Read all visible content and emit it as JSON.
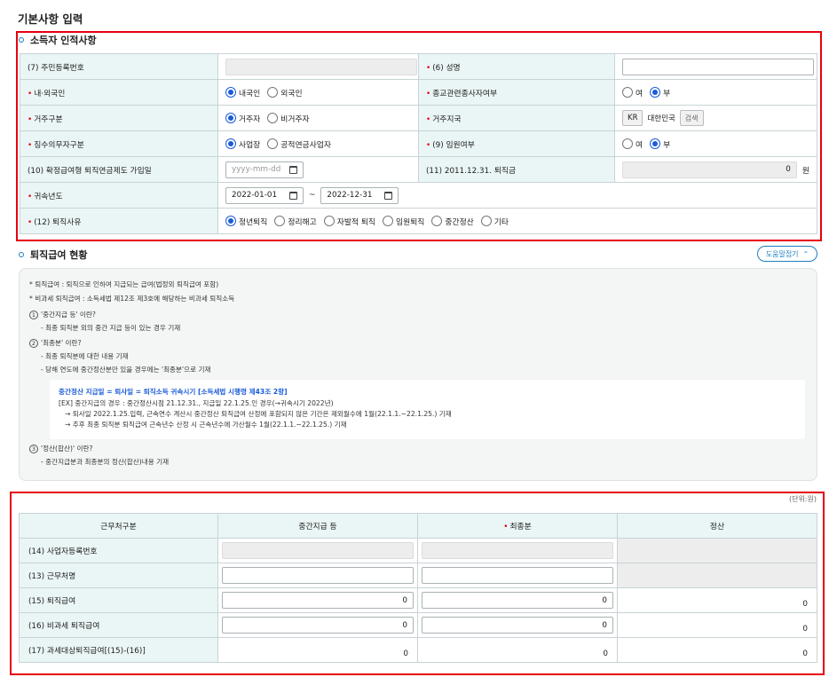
{
  "page_title": "기본사항 입력",
  "section1": {
    "title": "소득자 인적사항",
    "rows": {
      "resident_id_label": "(7) 주민등록번호",
      "name_label": "(6) 성명",
      "nationality_label": "내·외국인",
      "nationality_options": [
        "내국인",
        "외국인"
      ],
      "religion_label": "종교관련종사자여부",
      "religion_options": [
        "여",
        "부"
      ],
      "residence_label": "거주구분",
      "residence_options": [
        "거주자",
        "비거주자"
      ],
      "country_label": "거주지국",
      "country_code": "KR",
      "country_name": "대한민국",
      "country_search": "검색",
      "withholding_label": "징수의무자구분",
      "withholding_options": [
        "사업장",
        "공적연금사업자"
      ],
      "executive_label": "(9) 임원여부",
      "executive_options": [
        "여",
        "부"
      ],
      "pension_label": "(10) 확정급여형 퇴직연금제도 가입일",
      "pension_date_placeholder": "yyyy-mm-dd",
      "retire2011_label": "(11) 2011.12.31. 퇴직금",
      "retire2011_value": "0",
      "retire2011_unit": "원",
      "year_label": "귀속년도",
      "year_from": "2022-01-01",
      "year_tilde": "~",
      "year_to": "2022-12-31",
      "reason_label": "(12) 퇴직사유",
      "reason_options": [
        "정년퇴직",
        "정리해고",
        "자발적 퇴직",
        "임원퇴직",
        "중간정산",
        "기타"
      ]
    }
  },
  "section2": {
    "title": "퇴직급여 현황",
    "help_toggle": "도움말접기",
    "help": {
      "line1": "퇴직급여 : 퇴직으로 인하여 지급되는 급여(법정외 퇴직급여 포함)",
      "line2": "비과세 퇴직급여 : 소득세법 제12조 제3호에 해당하는 비과세 퇴직소득",
      "q1_num": "1",
      "q1": "'중간지급 등' 이란?",
      "q1_a": "- 최종 퇴직분 외의 중간 지급 등이 있는 경우 기재",
      "q2_num": "2",
      "q2": "'최종분' 이란?",
      "q2_a1": "- 최종 퇴직분에 대한 내용 기재",
      "q2_a2": "- 당해 연도에 중간정산분만 있을 경우에는 '최종분'으로 기재",
      "box_title": "중간정산 지급일 = 퇴사일 = 퇴직소득 귀속시기 [소득세법 시행령 제43조 2항]",
      "box_l1": "[EX] 중간지급의 경우 : 중간정산시점 21.12.31., 지급일 22.1.25.인 경우(→귀속시기 2022년)",
      "box_l2": "→ 퇴사일 2022.1.25.입력, 근속연수 계산시 중간정산 퇴직급여 산정에 포함되지 않은 기간은 제외월수에 1월(22.1.1.~22.1.25.) 기재",
      "box_l3": "→ 추후 최종 퇴직분 퇴직급여 근속년수 산정 시 근속년수에 가산월수 1월(22.1.1.~22.1.25.) 기재",
      "q3_num": "3",
      "q3": "'정산(합산)' 이란?",
      "q3_a": "- 중간지급분과 최종분의 정산(합산)내용 기재"
    },
    "unit": "(단위:원)",
    "grid": {
      "headers": [
        "근무처구분",
        "중간지급 등",
        "최종분",
        "정산"
      ],
      "rows": [
        {
          "label": "(14) 사업자등록번호"
        },
        {
          "label": "(13) 근무처명"
        },
        {
          "label": "(15) 퇴직급여",
          "mid": "0",
          "final": "0",
          "settle": "0"
        },
        {
          "label": "(16) 비과세 퇴직급여",
          "mid": "0",
          "final": "0",
          "settle": "0"
        },
        {
          "label": "(17) 과세대상퇴직급여[(15)-(16)]",
          "mid": "0",
          "final": "0",
          "settle": "0"
        }
      ]
    }
  }
}
